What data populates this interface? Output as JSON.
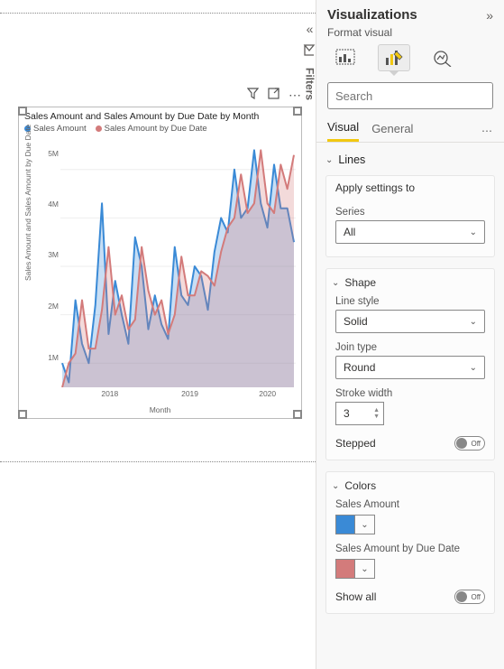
{
  "canvas": {
    "filters_tab": "Filters"
  },
  "chart": {
    "title": "Sales Amount and Sales Amount by Due Date by Month",
    "legend": {
      "s1": "Sales Amount",
      "s2": "Sales Amount by Due Date"
    },
    "ylabel": "Sales Amount and Sales Amount by Due Date",
    "xlabel": "Month",
    "yticks": [
      "1M",
      "2M",
      "3M",
      "4M",
      "5M"
    ],
    "xticks": [
      "2018",
      "2019",
      "2020"
    ]
  },
  "chart_data": {
    "type": "line",
    "title": "Sales Amount and Sales Amount by Due Date by Month",
    "xlabel": "Month",
    "ylabel": "Sales Amount and Sales Amount by Due Date",
    "ylim": [
      500000,
      5500000
    ],
    "x": [
      "2017-07",
      "2017-08",
      "2017-09",
      "2017-10",
      "2017-11",
      "2017-12",
      "2018-01",
      "2018-02",
      "2018-03",
      "2018-04",
      "2018-05",
      "2018-06",
      "2018-07",
      "2018-08",
      "2018-09",
      "2018-10",
      "2018-11",
      "2018-12",
      "2019-01",
      "2019-02",
      "2019-03",
      "2019-04",
      "2019-05",
      "2019-06",
      "2019-07",
      "2019-08",
      "2019-09",
      "2019-10",
      "2019-11",
      "2019-12",
      "2020-01",
      "2020-02",
      "2020-03",
      "2020-04",
      "2020-05",
      "2020-06"
    ],
    "x_tick_labels": [
      "2018",
      "2019",
      "2020"
    ],
    "series": [
      {
        "name": "Sales Amount",
        "color": "#3a8ad6",
        "values": [
          1000000,
          600000,
          2300000,
          1400000,
          1000000,
          2200000,
          4300000,
          1600000,
          2700000,
          2000000,
          1400000,
          3600000,
          3000000,
          1700000,
          2400000,
          1800000,
          1500000,
          3400000,
          2400000,
          2200000,
          3000000,
          2800000,
          2100000,
          3300000,
          4000000,
          3700000,
          5000000,
          4000000,
          4200000,
          5400000,
          4300000,
          3800000,
          5100000,
          4200000,
          4200000,
          3500000
        ]
      },
      {
        "name": "Sales Amount by Due Date",
        "color": "#d37b7b",
        "values": [
          500000,
          1000000,
          1200000,
          2300000,
          1300000,
          1300000,
          2100000,
          3400000,
          2000000,
          2400000,
          1700000,
          1900000,
          3400000,
          2500000,
          2000000,
          2300000,
          1600000,
          2000000,
          3200000,
          2400000,
          2400000,
          2900000,
          2800000,
          2600000,
          3300000,
          3800000,
          4000000,
          4900000,
          4100000,
          4300000,
          5400000,
          4300000,
          4100000,
          5100000,
          4600000,
          5300000
        ]
      }
    ]
  },
  "panel": {
    "title": "Visualizations",
    "subtitle": "Format visual",
    "search_placeholder": "Search",
    "tabs": {
      "visual": "Visual",
      "general": "General"
    },
    "sections": {
      "lines": "Lines",
      "apply_settings_to": "Apply settings to",
      "series_label": "Series",
      "series_value": "All",
      "shape": "Shape",
      "line_style_label": "Line style",
      "line_style_value": "Solid",
      "join_type_label": "Join type",
      "join_type_value": "Round",
      "stroke_width_label": "Stroke width",
      "stroke_width_value": "3",
      "stepped_label": "Stepped",
      "stepped_value": "Off",
      "colors": "Colors",
      "color1_label": "Sales Amount",
      "color1_hex": "#3a8ad6",
      "color2_label": "Sales Amount by Due Date",
      "color2_hex": "#d37b7b",
      "show_all_label": "Show all",
      "show_all_value": "Off"
    }
  }
}
